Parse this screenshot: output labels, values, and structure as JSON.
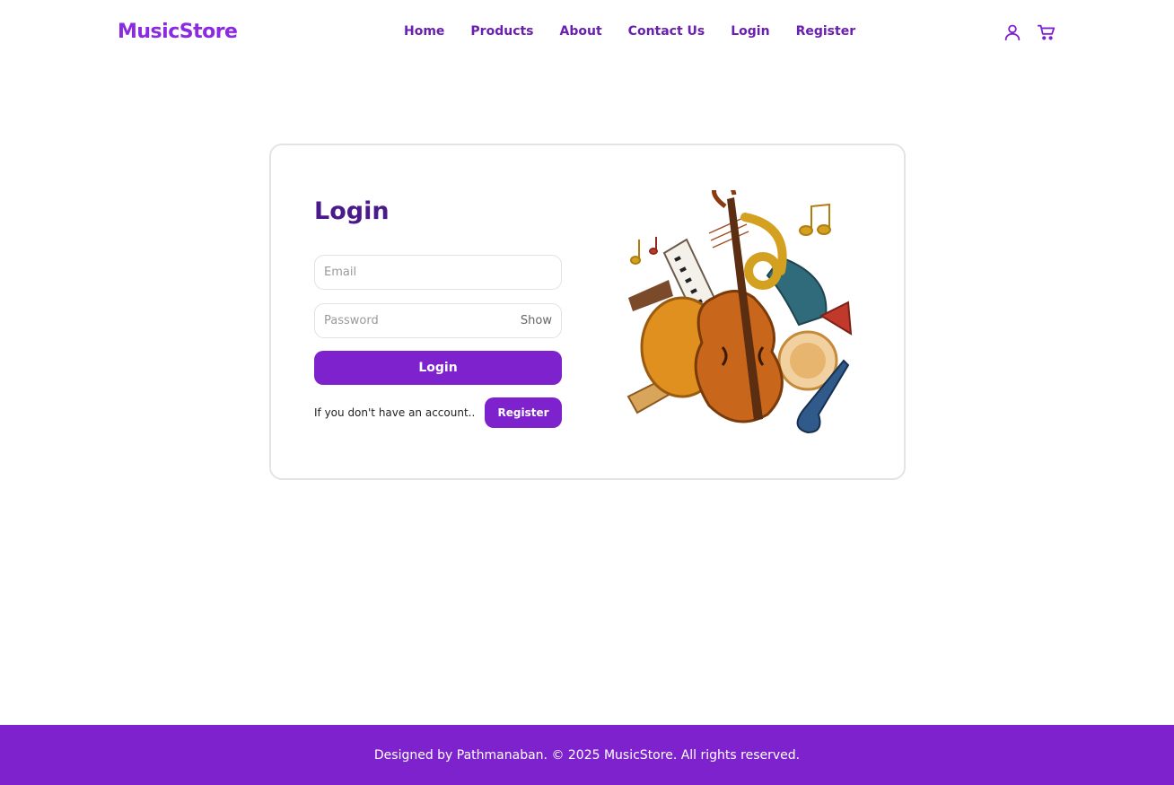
{
  "brand": {
    "name": "MusicStore"
  },
  "nav": {
    "links": [
      "Home",
      "Products",
      "About",
      "Contact Us",
      "Login",
      "Register"
    ],
    "icons": [
      "user-icon",
      "cart-icon"
    ]
  },
  "login": {
    "title": "Login",
    "email": {
      "placeholder": "Email",
      "value": ""
    },
    "password": {
      "placeholder": "Password",
      "value": "",
      "toggle_label": "Show"
    },
    "submit_label": "Login",
    "no_account_text": "If you don't have an account..",
    "register_label": "Register"
  },
  "illustration": {
    "icon": "musical-instruments-illustration"
  },
  "footer": {
    "text": "Designed by Pathmanaban. © 2025 MusicStore. All rights reserved."
  },
  "colors": {
    "brand": "#8a2be2",
    "nav_text": "#6a1fb0",
    "title": "#4b1a8a",
    "accent": "#7e22ce",
    "footer_bg": "#7e22ce"
  }
}
